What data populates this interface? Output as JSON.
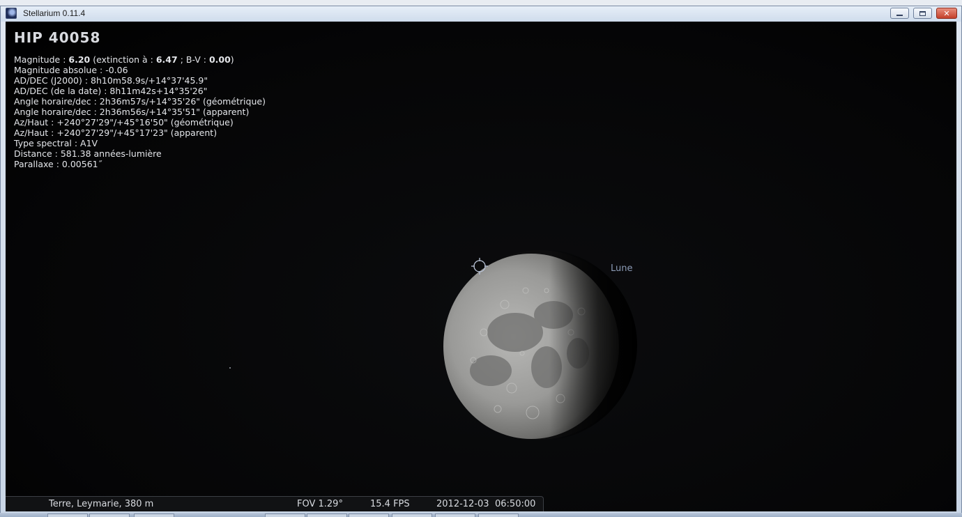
{
  "window": {
    "title": "Stellarium 0.11.4",
    "close_glyph": "✕"
  },
  "info": {
    "object_name": "HIP 40058",
    "magnitude_label": "Magnitude : ",
    "magnitude_value": "6.20",
    "extinction_label": " (extinction à  : ",
    "extinction_value": "6.47",
    "bv_label": "; B-V : ",
    "bv_value": "0.00",
    "bv_close": ")",
    "lines": [
      "Magnitude absolue : -0.06",
      "AD/DEC (J2000) : 8h10m58.9s/+14°37'45.9\"",
      "AD/DEC (de la date) : 8h11m42s+14°35'26\"",
      "Angle horaire/dec : 2h36m57s/+14°35'26\" (géométrique)",
      "Angle horaire/dec : 2h36m56s/+14°35'51\" (apparent)",
      "Az/Haut : +240°27'29\"/+45°16'50\" (géométrique)",
      "Az/Haut : +240°27'29\"/+45°17'23\" (apparent)",
      "Type spectral : A1V",
      "Distance : 581.38 années-lumière",
      "Parallaxe : 0.00561˝"
    ]
  },
  "sky": {
    "moon_label": "Lune"
  },
  "status": {
    "location": "Terre, Leymarie, 380 m",
    "fov": "FOV 1.29°",
    "fps": "15.4 FPS",
    "date": "2012-12-03",
    "time": "06:50:00"
  },
  "colors": {
    "sky": "#000000",
    "info_text": "#e4e6ea",
    "moon_label": "#8c9bb6",
    "close_button": "#c4412b"
  },
  "icons": [
    "stellarium-app-icon",
    "minimize-icon",
    "maximize-icon",
    "close-icon",
    "target-reticle-icon",
    "moon-icon"
  ]
}
